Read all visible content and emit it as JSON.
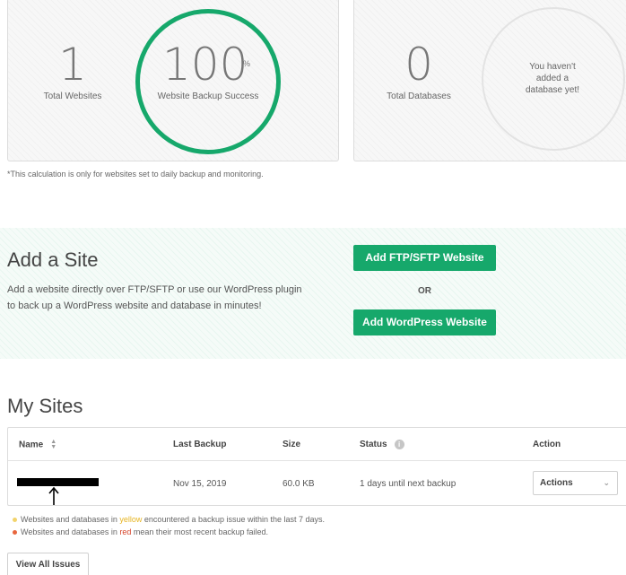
{
  "stats": {
    "websites": {
      "count": "1",
      "label": "Total Websites"
    },
    "backup": {
      "value": "100",
      "unit": "%",
      "label": "Website Backup Success",
      "fraction": 1.0
    },
    "databases": {
      "count": "0",
      "label": "Total Databases",
      "empty_message": "You haven't added a database yet!"
    },
    "note": "*This calculation is only for websites set to daily backup and monitoring."
  },
  "add_site": {
    "title": "Add a Site",
    "description": "Add a website directly over FTP/SFTP or use our WordPress plugin to back up a WordPress website and database in minutes!",
    "ftp_button": "Add FTP/SFTP Website",
    "or_label": "OR",
    "wp_button": "Add WordPress Website"
  },
  "my_sites": {
    "title": "My Sites",
    "columns": {
      "name": "Name",
      "last_backup": "Last Backup",
      "size": "Size",
      "status": "Status",
      "action": "Action"
    },
    "rows": [
      {
        "last_backup": "Nov 15, 2019",
        "size": "60.0 KB",
        "status": "1 days until next backup",
        "action": "Actions"
      }
    ],
    "legend": {
      "yellow": {
        "before": "Websites and databases in ",
        "word": "yellow",
        "after": " encountered a backup issue within the last 7 days."
      },
      "red": {
        "before": "Websites and databases in ",
        "word": "red",
        "after": " mean their most recent backup failed."
      }
    },
    "view_all_button": "View All Issues"
  },
  "colors": {
    "accent": "#16a86b",
    "yellow": "#e6b422",
    "red": "#d6442a"
  },
  "icons": {
    "sort": "sort-icon",
    "info": "info-icon",
    "dropdown": "chevron-down-icon",
    "pointer": "arrow-up-icon"
  }
}
